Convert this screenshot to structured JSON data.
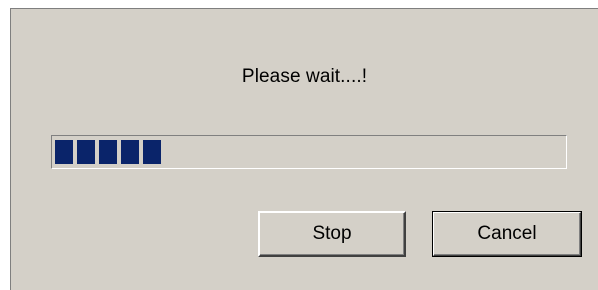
{
  "dialog": {
    "message": "Please wait....!",
    "progress": {
      "filled_blocks": 5,
      "fraction": 0.22,
      "fill_color": "#0a246a"
    },
    "buttons": {
      "stop_label": "Stop",
      "cancel_label": "Cancel"
    }
  }
}
